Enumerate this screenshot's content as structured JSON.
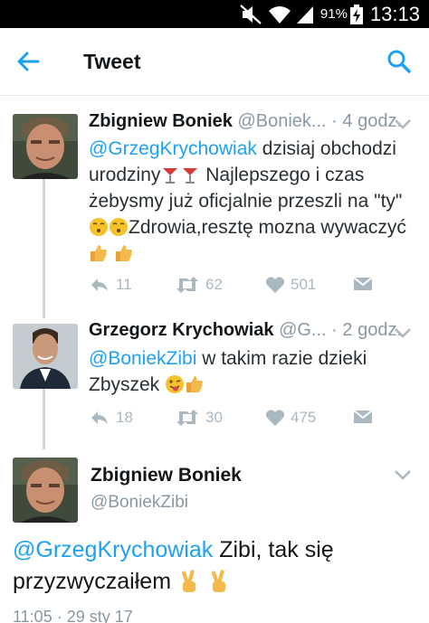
{
  "status_bar": {
    "battery": "91%",
    "time": "13:13",
    "icons": [
      "mute-icon",
      "wifi-icon",
      "signal-icon",
      "battery-charging-icon"
    ]
  },
  "app_bar": {
    "title": "Tweet",
    "back_icon": "arrow-left-icon",
    "search_icon": "search-icon",
    "accent": "#1da1f2"
  },
  "tweets": [
    {
      "name": "Zbigniew Boniek",
      "handle": "@Boniek...",
      "sep": "·",
      "time": "4 godz.",
      "mention": "@GrzegKrychowiak",
      "text_a": " dzisiaj obchodzi urodziny",
      "text_b": "Najlepszego i czas żebysmy już oficjalnie przeszli na \"ty\"",
      "text_c": "Zdrowia,resztę mozna wywaczyć",
      "replies": "11",
      "retweets": "62",
      "likes": "501"
    },
    {
      "name": "Grzegorz Krychowiak",
      "handle": "@G...",
      "sep": "·",
      "time": "2 godz.",
      "mention": "@BoniekZibi",
      "text_a": " w takim razie dzieki Zbyszek",
      "replies": "18",
      "retweets": "30",
      "likes": "475"
    }
  ],
  "focused": {
    "name": "Zbigniew Boniek",
    "handle": "@BoniekZibi",
    "mention": "@GrzegKrychowiak",
    "text": " Zibi, tak się przyzwyczaiłem",
    "timestamp": "11:05 · 29 sty 17"
  }
}
